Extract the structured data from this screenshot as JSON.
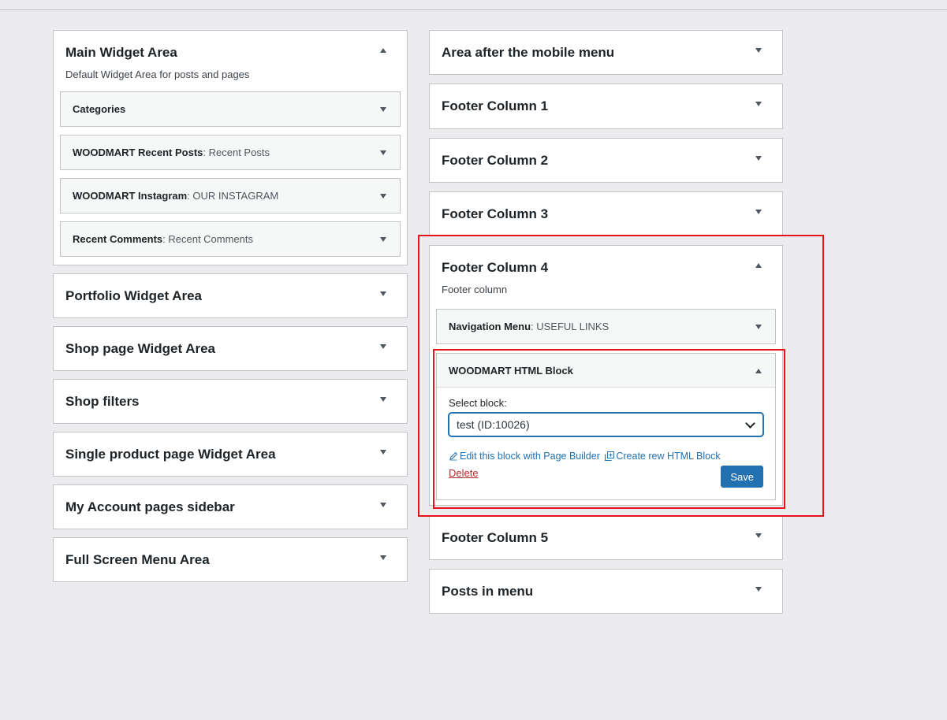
{
  "left_sidebars": [
    {
      "title": "Main Widget Area",
      "description": "Default Widget Area for posts and pages",
      "expanded": true,
      "widgets": [
        {
          "title": "Categories",
          "in_title": ""
        },
        {
          "title": "WOODMART Recent Posts",
          "in_title": ": Recent Posts"
        },
        {
          "title": "WOODMART Instagram",
          "in_title": ": OUR INSTAGRAM"
        },
        {
          "title": "Recent Comments",
          "in_title": ": Recent Comments"
        }
      ]
    },
    {
      "title": "Portfolio Widget Area"
    },
    {
      "title": "Shop page Widget Area"
    },
    {
      "title": "Shop filters"
    },
    {
      "title": "Single product page Widget Area"
    },
    {
      "title": "My Account pages sidebar"
    },
    {
      "title": "Full Screen Menu Area"
    }
  ],
  "right_sidebars": {
    "top": [
      {
        "title": "Area after the mobile menu"
      },
      {
        "title": "Footer Column 1"
      },
      {
        "title": "Footer Column 2"
      },
      {
        "title": "Footer Column 3"
      }
    ],
    "footer4": {
      "title": "Footer Column 4",
      "description": "Footer column",
      "nav_widget": {
        "title": "Navigation Menu",
        "in_title": ": USEFUL LINKS"
      },
      "html_block": {
        "title": "WOODMART HTML Block",
        "select_label": "Select block:",
        "select_value": "test (ID:10026)",
        "edit_link": "Edit this block with Page Builder",
        "create_link": "Create rew HTML Block",
        "delete_label": "Delete",
        "save_label": "Save"
      }
    },
    "bottom": [
      {
        "title": "Footer Column 5"
      },
      {
        "title": "Posts in menu"
      }
    ]
  },
  "colors": {
    "highlight": "#e4141b",
    "primary": "#2271b1",
    "delete": "#b32d2e"
  }
}
